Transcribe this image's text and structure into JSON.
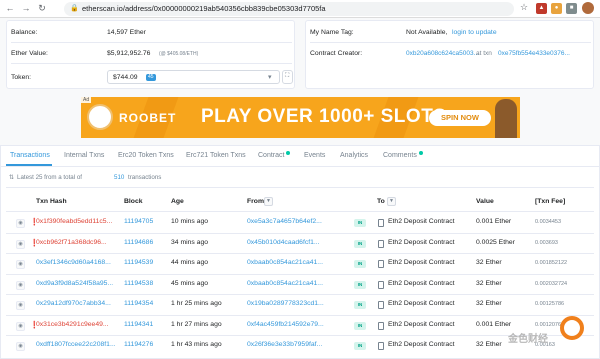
{
  "browser": {
    "url": "etherscan.io/address/0x00000000219ab540356cbb839cbe05303d7705fa",
    "back_icon": "arrow-left-icon",
    "forward_icon": "arrow-right-icon",
    "reload_icon": "reload-icon"
  },
  "overview": {
    "balance_label": "Balance:",
    "balance_value": "14,597 Ether",
    "ether_value_label": "Ether Value:",
    "ether_value": "$5,912,952.76",
    "ether_value_rate": "(@ $405.08/ETH)",
    "token_label": "Token:",
    "token_value": "$744.09",
    "token_count": "45"
  },
  "more_info": {
    "name_tag_label": "My Name Tag:",
    "name_tag_value": "Not Available,",
    "name_tag_link": "login to update",
    "creator_label": "Contract Creator:",
    "creator_address": "0xb20a608c624ca5003...",
    "creator_at": "at txn",
    "creator_txn": "0xe75fb554e433e0376..."
  },
  "banner": {
    "ad_label": "Ad",
    "brand": "ROOBET",
    "headline": "PLAY OVER 1000+ SLOTS",
    "cta": "SPIN NOW"
  },
  "tabs": [
    {
      "label": "Transactions"
    },
    {
      "label": "Internal Txns"
    },
    {
      "label": "Erc20 Token Txns"
    },
    {
      "label": "Erc721 Token Txns"
    },
    {
      "label": "Contract"
    },
    {
      "label": "Events"
    },
    {
      "label": "Analytics"
    },
    {
      "label": "Comments"
    }
  ],
  "summary": {
    "prefix": "Latest 25 from a total of",
    "count": "510",
    "suffix": "transactions"
  },
  "table": {
    "headers": {
      "txn_hash": "Txn Hash",
      "block": "Block",
      "age": "Age",
      "from": "From",
      "to": "To",
      "value": "Value",
      "fee": "[Txn Fee]"
    },
    "rows": [
      {
        "hash": "0x1f390feabd5edd11c5...",
        "error": true,
        "block": "11194705",
        "age": "10 mins ago",
        "from": "0xe5a3c7a4657b64ef2...",
        "dir": "IN",
        "to": "Eth2 Deposit Contract",
        "value": "0.001 Ether",
        "fee": "0.0034453"
      },
      {
        "hash": "0xcb962f71a368dc96...",
        "error": true,
        "block": "11194686",
        "age": "34 mins ago",
        "from": "0x45b010d4caad6fcf1...",
        "dir": "IN",
        "to": "Eth2 Deposit Contract",
        "value": "0.0025 Ether",
        "fee": "0.003693"
      },
      {
        "hash": "0x3ef1346c9d60a4168...",
        "error": false,
        "block": "11194539",
        "age": "44 mins ago",
        "from": "0xbaab0c854ac21ca41...",
        "dir": "IN",
        "to": "Eth2 Deposit Contract",
        "value": "32 Ether",
        "fee": "0.001852122"
      },
      {
        "hash": "0xd9a3f9d8a524f58a95...",
        "error": false,
        "block": "11194538",
        "age": "45 mins ago",
        "from": "0xbaab0c854ac21ca41...",
        "dir": "IN",
        "to": "Eth2 Deposit Contract",
        "value": "32 Ether",
        "fee": "0.002032724"
      },
      {
        "hash": "0x29a12df970c7abb34...",
        "error": false,
        "block": "11194354",
        "age": "1 hr 25 mins ago",
        "from": "0x19ba0289778323cd1...",
        "dir": "IN",
        "to": "Eth2 Deposit Contract",
        "value": "32 Ether",
        "fee": "0.00125786"
      },
      {
        "hash": "0x31ce3b4291c9ee49...",
        "error": true,
        "block": "11194341",
        "age": "1 hr 27 mins ago",
        "from": "0xf4ac459fb214592e79...",
        "dir": "IN",
        "to": "Eth2 Deposit Contract",
        "value": "0.001 Ether",
        "fee": "0.0012076"
      },
      {
        "hash": "0xdff1807fccee22c208f1...",
        "error": false,
        "block": "11194276",
        "age": "1 hr 43 mins ago",
        "from": "0x26f36e3e33b7959faf...",
        "dir": "IN",
        "to": "Eth2 Deposit Contract",
        "value": "32 Ether",
        "fee": "0.00163"
      }
    ]
  },
  "watermark": {
    "text": "金色财经"
  },
  "colors": {
    "link": "#3498db",
    "error": "#de4437",
    "banner": "#f7a51c",
    "in_badge": "#00a186"
  }
}
